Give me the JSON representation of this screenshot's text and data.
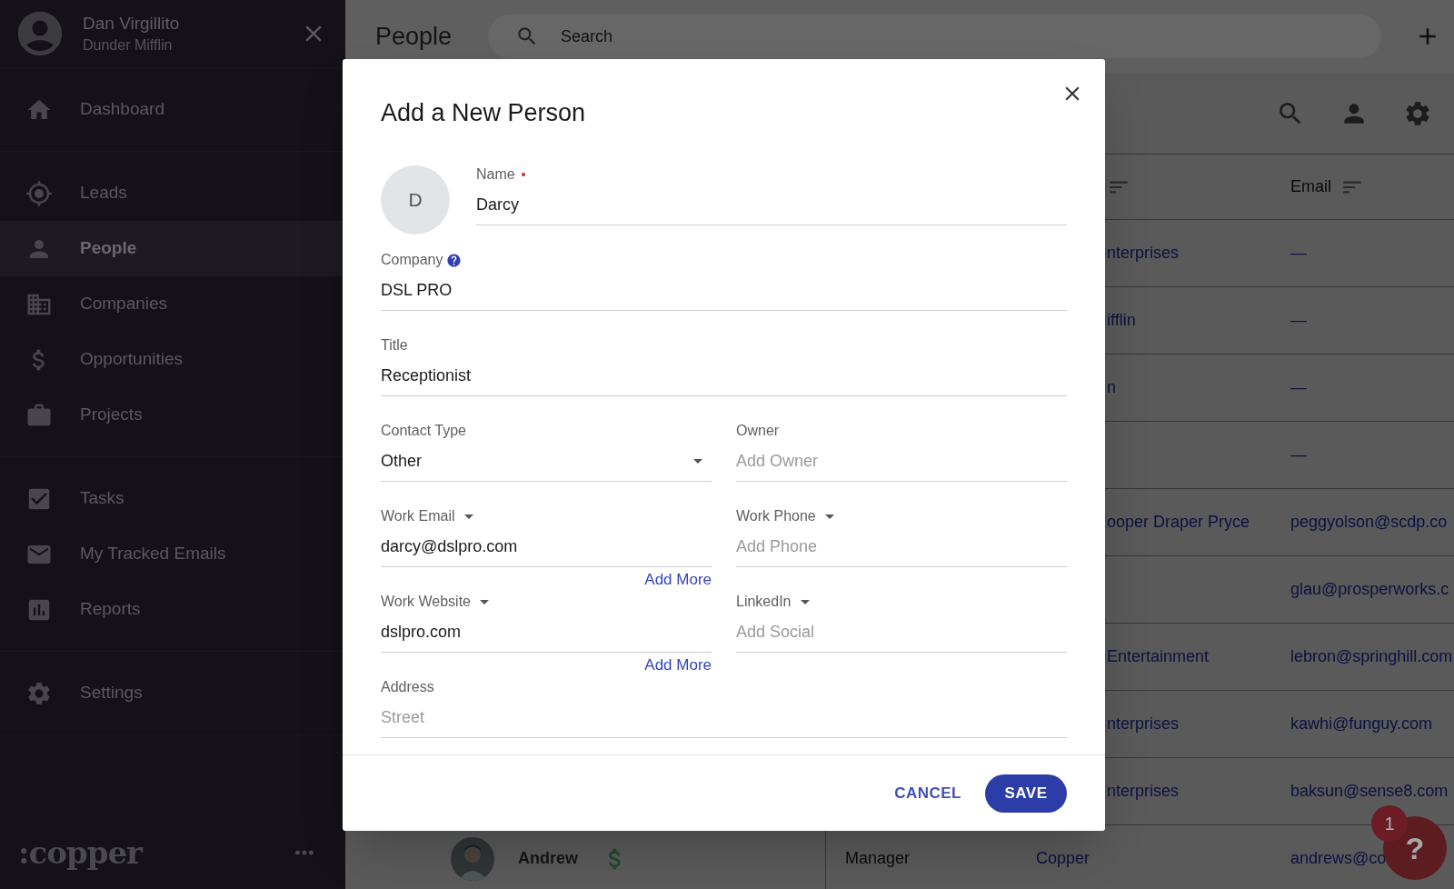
{
  "sidebar": {
    "user": {
      "name": "Dan Virgillito",
      "org": "Dunder Mifflin"
    },
    "sections": [
      {
        "items": [
          {
            "label": "Dashboard",
            "selected": false
          }
        ]
      },
      {
        "items": [
          {
            "label": "Leads",
            "selected": false
          },
          {
            "label": "People",
            "selected": true
          },
          {
            "label": "Companies",
            "selected": false
          },
          {
            "label": "Opportunities",
            "selected": false
          },
          {
            "label": "Projects",
            "selected": false
          }
        ]
      },
      {
        "items": [
          {
            "label": "Tasks",
            "selected": false
          },
          {
            "label": "My Tracked Emails",
            "selected": false
          },
          {
            "label": "Reports",
            "selected": false
          }
        ]
      },
      {
        "items": [
          {
            "label": "Settings",
            "selected": false
          }
        ]
      }
    ],
    "logo": ":copper"
  },
  "topbar": {
    "title": "People",
    "search": {
      "placeholder": "Search"
    }
  },
  "table": {
    "columns": [
      {
        "label": "Email"
      }
    ],
    "rows": [
      {
        "kind": "partial",
        "company": "nterprises",
        "email": "—"
      },
      {
        "kind": "partial",
        "company": "ifflin",
        "email": "—"
      },
      {
        "kind": "partial",
        "company": "n",
        "email": "—"
      },
      {
        "kind": "partial",
        "email": "—"
      },
      {
        "kind": "partial",
        "company": "ooper Draper Pryce",
        "email": "peggyolson@scdp.co"
      },
      {
        "kind": "partial",
        "email": "glau@prosperworks.c"
      },
      {
        "kind": "partial",
        "company": "Entertainment",
        "email": "lebron@springhill.com"
      },
      {
        "kind": "partial",
        "company": "nterprises",
        "email": "kawhi@funguy.com"
      },
      {
        "kind": "partial",
        "company": "nterprises",
        "email": "baksun@sense8.com"
      },
      {
        "kind": "full",
        "name": "Andrew",
        "title": "Manager",
        "company": "Copper",
        "email": "andrews@co"
      }
    ]
  },
  "dialog": {
    "title": "Add a New Person",
    "avatar": "D",
    "rows": [
      [
        {
          "kind": "input",
          "label": "Name",
          "required": true,
          "help": false,
          "label_menu": false,
          "value": "Darcy"
        }
      ],
      [
        {
          "kind": "input",
          "label": "Company",
          "required": false,
          "help": true,
          "label_menu": false,
          "value": "DSL PRO"
        }
      ],
      [
        {
          "kind": "input",
          "label": "Title",
          "required": false,
          "help": false,
          "label_menu": false,
          "value": "Receptionist"
        }
      ],
      [
        {
          "kind": "select",
          "label": "Contact Type",
          "required": false,
          "help": false,
          "label_menu": false,
          "value": "Other"
        },
        {
          "kind": "input",
          "label": "Owner",
          "required": false,
          "help": false,
          "label_menu": false,
          "placeholder": "Add Owner"
        }
      ],
      [
        {
          "kind": "input",
          "label": "Work Email",
          "required": false,
          "help": false,
          "label_menu": true,
          "value": "darcy@dslpro.com",
          "link": "Add More"
        },
        {
          "kind": "input",
          "label": "Work Phone",
          "required": false,
          "help": false,
          "label_menu": true,
          "placeholder": "Add Phone"
        }
      ],
      [
        {
          "kind": "input",
          "label": "Work Website",
          "required": false,
          "help": false,
          "label_menu": true,
          "value": "dslpro.com",
          "link": "Add More"
        },
        {
          "kind": "input",
          "label": "LinkedIn",
          "required": false,
          "help": false,
          "label_menu": true,
          "placeholder": "Add Social"
        }
      ],
      [
        {
          "kind": "input",
          "label": "Address",
          "required": false,
          "help": false,
          "label_menu": false,
          "placeholder": "Street"
        }
      ]
    ],
    "actions": [
      {
        "kind": "text",
        "label": "CANCEL"
      },
      {
        "kind": "primary",
        "label": "SAVE"
      }
    ]
  },
  "help": {
    "label": "?",
    "badge": "1"
  }
}
